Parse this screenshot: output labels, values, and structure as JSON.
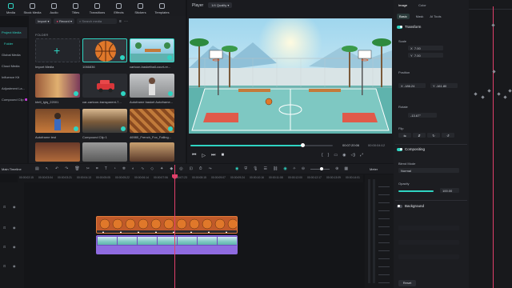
{
  "toolbar": {
    "items": [
      {
        "label": "Media",
        "icon": "media-icon"
      },
      {
        "label": "Stock Media",
        "icon": "stock-media-icon"
      },
      {
        "label": "Audio",
        "icon": "audio-icon"
      },
      {
        "label": "Titles",
        "icon": "titles-icon"
      },
      {
        "label": "Transitions",
        "icon": "transitions-icon"
      },
      {
        "label": "Effects",
        "icon": "effects-icon"
      },
      {
        "label": "Stickers",
        "icon": "stickers-icon"
      },
      {
        "label": "Templates",
        "icon": "templates-icon"
      }
    ]
  },
  "sidebar": {
    "items": [
      {
        "label": "Project Media",
        "active": true
      },
      {
        "label": "Folder",
        "active": false
      },
      {
        "label": "Global Media",
        "active": false
      },
      {
        "label": "Cloud Media",
        "active": false
      },
      {
        "label": "Influence Kit",
        "active": false
      },
      {
        "label": "Adjustment La...",
        "active": false
      },
      {
        "label": "Compound Clip",
        "active": false
      }
    ]
  },
  "media": {
    "import_label": "Import",
    "record_label": "Record",
    "search_placeholder": "Search media",
    "folder_label": "FOLDER",
    "items": [
      {
        "label": "Import Media"
      },
      {
        "label": "1066836"
      },
      {
        "label": "cartoon-basketball-court-re..."
      },
      {
        "label": "khrit_lglq_22001"
      },
      {
        "label": "car-cartoon-transparent-7..."
      },
      {
        "label": "Autoframe basket Autoframe..."
      },
      {
        "label": "Autoframe test"
      },
      {
        "label": "Compound Clip 1"
      },
      {
        "label": "46980_French_Fox_Falling..."
      }
    ]
  },
  "player": {
    "tab_player": "Player",
    "quality": "1/4 Quality",
    "current_time": "00:07:20:06",
    "total_time": "00:00:04:12",
    "progress": 0.79
  },
  "props": {
    "tabs": [
      "Image",
      "Color"
    ],
    "subtabs": [
      "Basic",
      "Mask",
      "AI Tools"
    ],
    "transform": "Transform",
    "scale": "Scale",
    "scale_x": "7.00",
    "scale_y": "7.00",
    "position": "Position",
    "position_x": "-186.24",
    "position_y": "-161.80",
    "rotate": "Rotate",
    "rotate_value": "-13.67°",
    "flip": "Flip",
    "compositing": "Compositing",
    "blend_mode": "Blend Mode",
    "blend_value": "Normal",
    "opacity": "Opacity",
    "opacity_value": "100.00",
    "background": "Background",
    "reset": "Reset"
  },
  "timeline": {
    "title": "Main Timeline",
    "meter": "Meter",
    "ticks": [
      "00:00:02:15",
      "00:00:03:04",
      "00:00:03:21",
      "00:00:04:13",
      "00:00:05:05",
      "00:00:05:22",
      "00:00:06:14",
      "00:00:07:06",
      "00:00:07:23",
      "00:00:08:15",
      "00:00:09:07",
      "00:00:09:24",
      "00:00:10:16",
      "00:00:11:08",
      "00:00:12:00",
      "00:00:12:17",
      "00:00:13:09",
      "00:00:14:01"
    ]
  },
  "colors": {
    "accent": "#2fd4c2",
    "playhead": "#e0406a",
    "clip_orange": "#c05a2a",
    "clip_purple": "#8f6be0"
  }
}
